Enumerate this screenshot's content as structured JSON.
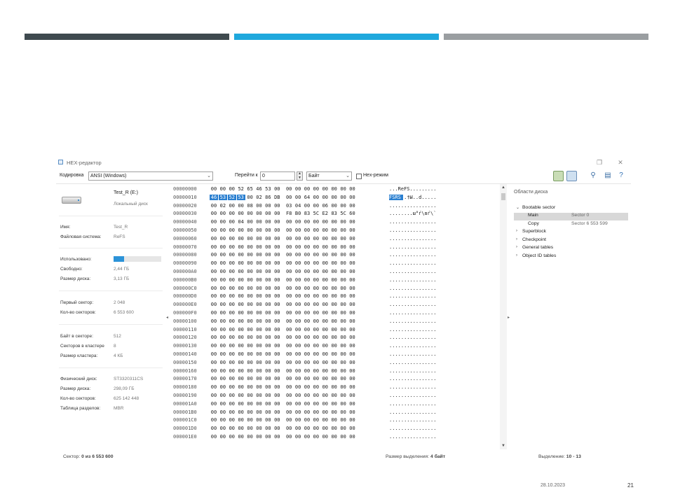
{
  "window": {
    "title": "HEX-редактор"
  },
  "toolbar": {
    "encoding_label": "Кодировка",
    "encoding_value": "ANSI (Windows)",
    "goto_label": "Перейти к",
    "goto_value": "0",
    "unit_value": "Байт",
    "hex_mode_label": "Hex-режим"
  },
  "disk": {
    "name": "Test_R (E:)",
    "type": "Локальный диск",
    "props": [
      {
        "k": "Имя:",
        "v": "Test_R"
      },
      {
        "k": "Файловая система:",
        "v": "ReFS"
      },
      {
        "k": "Использовано:",
        "v": ""
      },
      {
        "k": "Свободно:",
        "v": "2,44 ГБ"
      },
      {
        "k": "Размер диска:",
        "v": "3,13 ГБ"
      },
      {
        "k": "Первый сектор:",
        "v": "2 048"
      },
      {
        "k": "Кол-во секторов:",
        "v": "6 553 600"
      },
      {
        "k": "Байт в секторе:",
        "v": "512"
      },
      {
        "k": "Секторов в кластере",
        "v": "8"
      },
      {
        "k": "Размер кластера:",
        "v": "4 КБ"
      },
      {
        "k": "Физический диск:",
        "v": "ST3320311CS"
      },
      {
        "k": "Размер диска:",
        "v": "298,09 ГБ"
      },
      {
        "k": "Кол-во секторов:",
        "v": "625 142 448"
      },
      {
        "k": "Таблица разделов:",
        "v": "MBR"
      }
    ],
    "used_fraction": 0.22
  },
  "hex": {
    "rows": [
      {
        "off": "00000000",
        "bytes": [
          "00",
          "00",
          "00",
          "52",
          "65",
          "46",
          "53",
          "00",
          "00",
          "00",
          "00",
          "00",
          "00",
          "00",
          "00",
          "00"
        ],
        "ascii": "...ReFS........."
      },
      {
        "off": "00000010",
        "bytes": [
          "46",
          "53",
          "52",
          "53",
          "00",
          "02",
          "86",
          "DB",
          "00",
          "00",
          "64",
          "00",
          "00",
          "00",
          "00",
          "00"
        ],
        "ascii": "FSRS..†Ы..d....."
      },
      {
        "off": "00000020",
        "bytes": [
          "00",
          "02",
          "00",
          "00",
          "08",
          "00",
          "00",
          "00",
          "03",
          "04",
          "00",
          "00",
          "06",
          "00",
          "00",
          "00"
        ],
        "ascii": "................"
      },
      {
        "off": "00000030",
        "bytes": [
          "00",
          "00",
          "00",
          "00",
          "00",
          "00",
          "00",
          "00",
          "F8",
          "B0",
          "83",
          "5C",
          "E2",
          "83",
          "5C",
          "60"
        ],
        "ascii": "........ш°ѓ\\вѓ\\`"
      },
      {
        "off": "00000040",
        "bytes": [
          "00",
          "00",
          "00",
          "04",
          "00",
          "00",
          "00",
          "00",
          "00",
          "00",
          "00",
          "00",
          "00",
          "00",
          "00",
          "00"
        ],
        "ascii": "................"
      },
      {
        "off": "00000050",
        "bytes": [
          "00",
          "00",
          "00",
          "00",
          "00",
          "00",
          "00",
          "00",
          "00",
          "00",
          "00",
          "00",
          "00",
          "00",
          "00",
          "00"
        ],
        "ascii": "................"
      },
      {
        "off": "00000060",
        "bytes": [
          "00",
          "00",
          "00",
          "00",
          "00",
          "00",
          "00",
          "00",
          "00",
          "00",
          "00",
          "00",
          "00",
          "00",
          "00",
          "00"
        ],
        "ascii": "................"
      },
      {
        "off": "00000070",
        "bytes": [
          "00",
          "00",
          "00",
          "00",
          "00",
          "00",
          "00",
          "00",
          "00",
          "00",
          "00",
          "00",
          "00",
          "00",
          "00",
          "00"
        ],
        "ascii": "................"
      },
      {
        "off": "00000080",
        "bytes": [
          "00",
          "00",
          "00",
          "00",
          "00",
          "00",
          "00",
          "00",
          "00",
          "00",
          "00",
          "00",
          "00",
          "00",
          "00",
          "00"
        ],
        "ascii": "................"
      },
      {
        "off": "00000090",
        "bytes": [
          "00",
          "00",
          "00",
          "00",
          "00",
          "00",
          "00",
          "00",
          "00",
          "00",
          "00",
          "00",
          "00",
          "00",
          "00",
          "00"
        ],
        "ascii": "................"
      },
      {
        "off": "000000A0",
        "bytes": [
          "00",
          "00",
          "00",
          "00",
          "00",
          "00",
          "00",
          "00",
          "00",
          "00",
          "00",
          "00",
          "00",
          "00",
          "00",
          "00"
        ],
        "ascii": "................"
      },
      {
        "off": "000000B0",
        "bytes": [
          "00",
          "00",
          "00",
          "00",
          "00",
          "00",
          "00",
          "00",
          "00",
          "00",
          "00",
          "00",
          "00",
          "00",
          "00",
          "00"
        ],
        "ascii": "................"
      },
      {
        "off": "000000C0",
        "bytes": [
          "00",
          "00",
          "00",
          "00",
          "00",
          "00",
          "00",
          "00",
          "00",
          "00",
          "00",
          "00",
          "00",
          "00",
          "00",
          "00"
        ],
        "ascii": "................"
      },
      {
        "off": "000000D0",
        "bytes": [
          "00",
          "00",
          "00",
          "00",
          "00",
          "00",
          "00",
          "00",
          "00",
          "00",
          "00",
          "00",
          "00",
          "00",
          "00",
          "00"
        ],
        "ascii": "................"
      },
      {
        "off": "000000E0",
        "bytes": [
          "00",
          "00",
          "00",
          "00",
          "00",
          "00",
          "00",
          "00",
          "00",
          "00",
          "00",
          "00",
          "00",
          "00",
          "00",
          "00"
        ],
        "ascii": "................"
      },
      {
        "off": "000000F0",
        "bytes": [
          "00",
          "00",
          "00",
          "00",
          "00",
          "00",
          "00",
          "00",
          "00",
          "00",
          "00",
          "00",
          "00",
          "00",
          "00",
          "00"
        ],
        "ascii": "................"
      },
      {
        "off": "00000100",
        "bytes": [
          "00",
          "00",
          "00",
          "00",
          "00",
          "00",
          "00",
          "00",
          "00",
          "00",
          "00",
          "00",
          "00",
          "00",
          "00",
          "00"
        ],
        "ascii": "................"
      },
      {
        "off": "00000110",
        "bytes": [
          "00",
          "00",
          "00",
          "00",
          "00",
          "00",
          "00",
          "00",
          "00",
          "00",
          "00",
          "00",
          "00",
          "00",
          "00",
          "00"
        ],
        "ascii": "................"
      },
      {
        "off": "00000120",
        "bytes": [
          "00",
          "00",
          "00",
          "00",
          "00",
          "00",
          "00",
          "00",
          "00",
          "00",
          "00",
          "00",
          "00",
          "00",
          "00",
          "00"
        ],
        "ascii": "................"
      },
      {
        "off": "00000130",
        "bytes": [
          "00",
          "00",
          "00",
          "00",
          "00",
          "00",
          "00",
          "00",
          "00",
          "00",
          "00",
          "00",
          "00",
          "00",
          "00",
          "00"
        ],
        "ascii": "................"
      },
      {
        "off": "00000140",
        "bytes": [
          "00",
          "00",
          "00",
          "00",
          "00",
          "00",
          "00",
          "00",
          "00",
          "00",
          "00",
          "00",
          "00",
          "00",
          "00",
          "00"
        ],
        "ascii": "................"
      },
      {
        "off": "00000150",
        "bytes": [
          "00",
          "00",
          "00",
          "00",
          "00",
          "00",
          "00",
          "00",
          "00",
          "00",
          "00",
          "00",
          "00",
          "00",
          "00",
          "00"
        ],
        "ascii": "................"
      },
      {
        "off": "00000160",
        "bytes": [
          "00",
          "00",
          "00",
          "00",
          "00",
          "00",
          "00",
          "00",
          "00",
          "00",
          "00",
          "00",
          "00",
          "00",
          "00",
          "00"
        ],
        "ascii": "................"
      },
      {
        "off": "00000170",
        "bytes": [
          "00",
          "00",
          "00",
          "00",
          "00",
          "00",
          "00",
          "00",
          "00",
          "00",
          "00",
          "00",
          "00",
          "00",
          "00",
          "00"
        ],
        "ascii": "................"
      },
      {
        "off": "00000180",
        "bytes": [
          "00",
          "00",
          "00",
          "00",
          "00",
          "00",
          "00",
          "00",
          "00",
          "00",
          "00",
          "00",
          "00",
          "00",
          "00",
          "00"
        ],
        "ascii": "................"
      },
      {
        "off": "00000190",
        "bytes": [
          "00",
          "00",
          "00",
          "00",
          "00",
          "00",
          "00",
          "00",
          "00",
          "00",
          "00",
          "00",
          "00",
          "00",
          "00",
          "00"
        ],
        "ascii": "................"
      },
      {
        "off": "000001A0",
        "bytes": [
          "00",
          "00",
          "00",
          "00",
          "00",
          "00",
          "00",
          "00",
          "00",
          "00",
          "00",
          "00",
          "00",
          "00",
          "00",
          "00"
        ],
        "ascii": "................"
      },
      {
        "off": "000001B0",
        "bytes": [
          "00",
          "00",
          "00",
          "00",
          "00",
          "00",
          "00",
          "00",
          "00",
          "00",
          "00",
          "00",
          "00",
          "00",
          "00",
          "00"
        ],
        "ascii": "................"
      },
      {
        "off": "000001C0",
        "bytes": [
          "00",
          "00",
          "00",
          "00",
          "00",
          "00",
          "00",
          "00",
          "00",
          "00",
          "00",
          "00",
          "00",
          "00",
          "00",
          "00"
        ],
        "ascii": "................"
      },
      {
        "off": "000001D0",
        "bytes": [
          "00",
          "00",
          "00",
          "00",
          "00",
          "00",
          "00",
          "00",
          "00",
          "00",
          "00",
          "00",
          "00",
          "00",
          "00",
          "00"
        ],
        "ascii": "................"
      },
      {
        "off": "000001E0",
        "bytes": [
          "00",
          "00",
          "00",
          "00",
          "00",
          "00",
          "00",
          "00",
          "00",
          "00",
          "00",
          "00",
          "00",
          "00",
          "00",
          "00"
        ],
        "ascii": "................"
      }
    ],
    "selection": {
      "row": 1,
      "from": 0,
      "to": 3
    }
  },
  "areas": {
    "title": "Области диска",
    "items": [
      {
        "label": "Bootable sector",
        "expanded": true,
        "children": [
          {
            "label": "Main",
            "value": "Sector 0",
            "selected": true
          },
          {
            "label": "Copy",
            "value": "Sector 6 553 599",
            "selected": false
          }
        ]
      },
      {
        "label": "Superblock",
        "expanded": false,
        "children": []
      },
      {
        "label": "Checkpoint",
        "expanded": false,
        "children": []
      },
      {
        "label": "General tables",
        "expanded": false,
        "children": []
      },
      {
        "label": "Object ID tables",
        "expanded": false,
        "children": []
      }
    ]
  },
  "status": {
    "sector_label": "Сектор:",
    "sector_value": "0 из 6 553 600",
    "sel_size_label": "Размер выделения:",
    "sel_size_value": "4 байт",
    "selection_label": "Выделение:",
    "selection_value": "10 - 13"
  },
  "footer": {
    "date": "28.10.2023",
    "page": "21"
  },
  "colors": {
    "accent": "#1fa8dd",
    "dark": "#3f4a4f",
    "grey": "#9a9ea1",
    "selection": "#2a7fd0"
  }
}
